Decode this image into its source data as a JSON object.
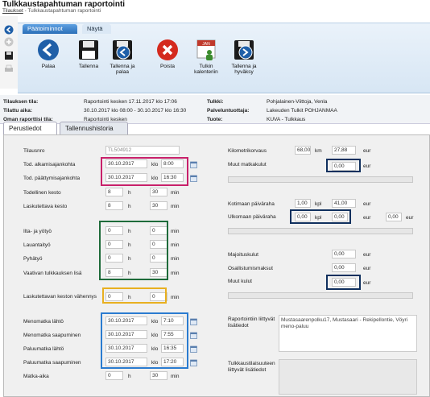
{
  "header": {
    "title": "Tulkkaustapahtuman raportointi",
    "breadcrumb_link": "Tilaukset",
    "breadcrumb_current": "- Tulkkaustapahtuman raportointi"
  },
  "ribbon": {
    "tabs": [
      {
        "label": "Päätoiminnot"
      },
      {
        "label": "Näytä"
      }
    ],
    "buttons": [
      {
        "label": "Palaa",
        "icon": "back-arrow-icon"
      },
      {
        "label": "Tallenna",
        "icon": "floppy-save-icon"
      },
      {
        "label": "Tallenna ja palaa",
        "icon": "save-and-return-icon"
      },
      {
        "label": "Poista",
        "icon": "delete-x-icon"
      },
      {
        "label": "Tulkin kalenteriin",
        "icon": "calendar-person-icon"
      },
      {
        "label": "Tallenna ja hyväksy",
        "icon": "save-and-approve-icon"
      }
    ]
  },
  "info": {
    "tilauksen_tila_label": "Tilauksen tila:",
    "tilauksen_tila": "Raportointi kesken 17.11.2017 klo 17:06",
    "tilattu_aika_label": "Tilattu aika:",
    "tilattu_aika": "30.10.2017 klo 08:00 - 30.10.2017 klo 16:30",
    "oman_raportin_tila_label": "Oman raporttisi tila:",
    "oman_raportin_tila": "Raportointi kesken",
    "tulkki_label": "Tulkki:",
    "tulkki": "Pohjalainen-Viittoja, Venla",
    "palveluntuottaja_label": "Palveluntuottaja:",
    "palveluntuottaja": "Lakeuden Tulkit POHJANMAA",
    "tuote_label": "Tuote:",
    "tuote": "KUVA - Tulkkaus"
  },
  "page_tabs": [
    {
      "label": "Perustiedot"
    },
    {
      "label": "Tallennushistoria"
    }
  ],
  "form": {
    "tilausnro_label": "Tilausnro",
    "tilausnro": "TL504912",
    "alku_label": "Tod. alkamisajankohta",
    "alku_date": "30.10.2017",
    "alku_time": "8:00",
    "paatty_label": "Tod. päättymisajankohta",
    "paatty_date": "30.10.2017",
    "paatty_time": "16:30",
    "kesto_label": "Todellinen kesto",
    "kesto_h": "8",
    "kesto_min": "30",
    "lask_kesto_label": "Laskutettava kesto",
    "lask_kesto_h": "8",
    "lask_kesto_min": "30",
    "ilta_label": "Ilta- ja yötyö",
    "ilta_h": "0",
    "ilta_min": "0",
    "lauantai_label": "Lauantaityö",
    "lauantai_h": "0",
    "lauantai_min": "0",
    "pyha_label": "Pyhätyö",
    "pyha_h": "0",
    "pyha_min": "0",
    "vaativa_label": "Vaativan tulkkauksen lisä",
    "vaativa_h": "8",
    "vaativa_min": "30",
    "vahennys_label": "Laskutettavan keston vähennys",
    "vahennys_h": "0",
    "vahennys_min": "0",
    "meno_lahto_label": "Menomatka lähtö",
    "meno_lahto_date": "30.10.2017",
    "meno_lahto_time": "7:10",
    "meno_saap_label": "Menomatka saapuminen",
    "meno_saap_date": "30.10.2017",
    "meno_saap_time": "7:55",
    "paluu_lahto_label": "Paluumatka lähtö",
    "paluu_lahto_date": "30.10.2017",
    "paluu_lahto_time": "16:35",
    "paluu_saap_label": "Paluumatka saapuminen",
    "paluu_saap_date": "30.10.2017",
    "paluu_saap_time": "17:20",
    "matka_aika_label": "Matka-aika",
    "matka_aika_h": "0",
    "matka_aika_min": "30",
    "unit_h": "h",
    "unit_min": "min",
    "unit_klo": "klo",
    "km_label": "Kilometrikorvaus",
    "km_value": "68,00",
    "km_unit": "km",
    "km_eur": "27,88",
    "muut_matka_label": "Muut matkakulut",
    "muut_matka": "0,00",
    "kotimaan_label": "Kotimaan päiväraha",
    "kotimaan_kpl": "1,00",
    "kotimaan_eur": "41,00",
    "ulkomaan_label": "Ulkomaan päiväraha",
    "ulkomaan_kpl": "0,00",
    "ulkomaan_eur": "0,00",
    "ulkomaan_eur2": "0,00",
    "majoitus_label": "Majoituskulut",
    "majoitus": "0,00",
    "osallistuminen_label": "Osallistumismaksut",
    "osallistuminen": "0,00",
    "muut_kulut_label": "Muut kulut",
    "muut_kulut": "0,00",
    "unit_eur": "eur",
    "unit_kpl": "kpl",
    "raportointi_label": "Raportointiin liittyvät lisätiedot",
    "raportointi_text": "Mustasaarenpolku17, Mustasaari - Rekipellontie, Vöyri meno-paluu",
    "tulkkaus_label": "Tulkkaustilaisuuteen liittyvät lisätiedot"
  },
  "colors": {
    "pink_highlight": "#c8206a",
    "green_highlight": "#1e6b3a",
    "yellow_highlight": "#e8b020",
    "blue_highlight": "#2a7bd0",
    "navy_highlight": "#10305e",
    "ribbon_tab": "#2b6fb8"
  }
}
